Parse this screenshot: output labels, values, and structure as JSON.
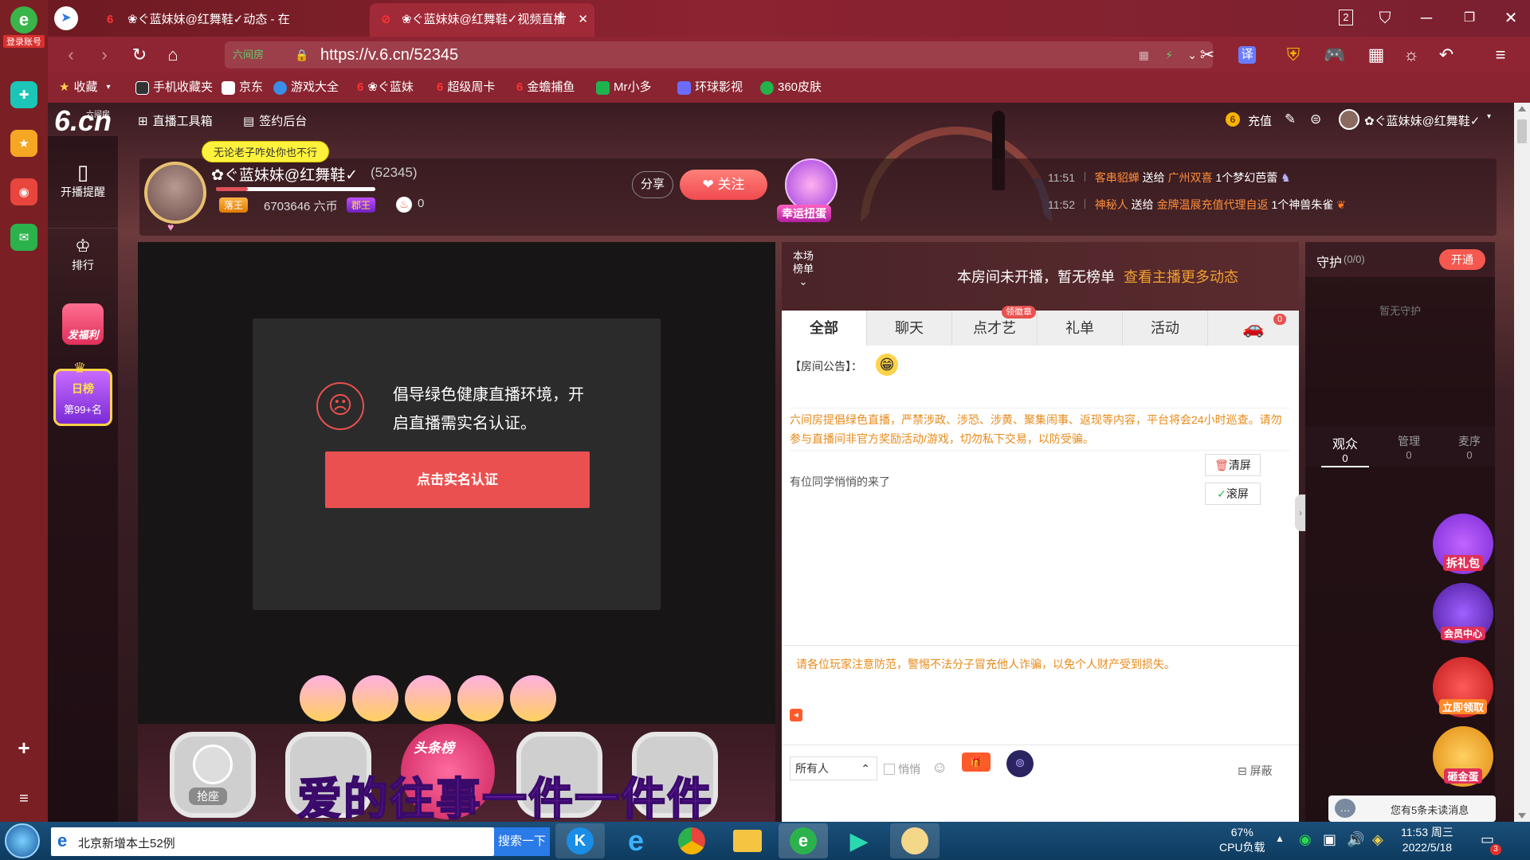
{
  "browser": {
    "login_label": "登录账号",
    "tabs": [
      {
        "title": "❀ぐ蓝妹妹@红舞鞋✓动态 - 在"
      },
      {
        "title": "❀ぐ蓝妹妹@红舞鞋✓视频直播"
      }
    ],
    "tab_count": "2",
    "url": "https://v.6.cn/52345",
    "site_badge": "六间房",
    "bookmarks": [
      {
        "label": "收藏"
      },
      {
        "label": "手机收藏夹"
      },
      {
        "label": "京东"
      },
      {
        "label": "游戏大全"
      },
      {
        "label": "❀ぐ蓝妹"
      },
      {
        "label": "超级周卡"
      },
      {
        "label": "金蟾捕鱼"
      },
      {
        "label": "Mr小多"
      },
      {
        "label": "环球影视"
      },
      {
        "label": "360皮肤"
      }
    ]
  },
  "site": {
    "logo": "6.cn",
    "logo_sub": "六间房",
    "tools": [
      "直播工具箱",
      "签约后台"
    ],
    "recharge": "充值",
    "user_name": "✿ぐ蓝妹妹@红舞鞋✓",
    "left_nav": [
      {
        "label": "开播提醒"
      },
      {
        "label": "排行"
      },
      {
        "label": "发福利"
      },
      {
        "label": "日榜",
        "sub": "第99+名"
      }
    ]
  },
  "anchor": {
    "tooltip": "无论老子咋处你也不行",
    "name": "✿ぐ蓝妹妹@红舞鞋✓",
    "room_id": "(52345)",
    "badge1": "落王",
    "coins": "6703646 六币",
    "badge2": "郡王",
    "heat": "0",
    "share": "分享",
    "follow": "关注",
    "lucky": "幸运扭蛋"
  },
  "feed": [
    {
      "time": "11:51",
      "from": "客串貂蝉",
      "verb": "送给",
      "to": "广州双喜",
      "gift": "1个梦幻芭蕾"
    },
    {
      "time": "11:52",
      "from": "神秘人",
      "verb": "送给",
      "to": "金牌温展充值代理自返",
      "gift": "1个神兽朱雀"
    }
  ],
  "video": {
    "notice_line1": "倡导绿色健康直播环境，开",
    "notice_line2": "启直播需实名认证。",
    "auth_button": "点击实名认证",
    "seat_label": "抢座",
    "headline_badge": "头条榜",
    "lyrics": "爱的往事一件一件件"
  },
  "rank": {
    "label_line1": "本场",
    "label_line2": "榜单",
    "empty": "本房间未开播，暂无榜单",
    "link": "查看主播更多动态"
  },
  "chat": {
    "tabs": [
      "全部",
      "聊天",
      "点才艺",
      "礼单",
      "活动"
    ],
    "tab_badge": "领徽章",
    "car_count": "0",
    "announce_label": "【房间公告】：",
    "rules": "六间房提倡绿色直播，严禁涉政、涉恐、涉黄、聚集闹事、返现等内容，平台将会24小时巡查。请勿参与直播间非官方奖励活动/游戏，切勿私下交易，以防受骗。",
    "message": "有位同学悄悄的来了",
    "clear": "清屏",
    "scroll": "滚屏",
    "warning": "请各位玩家注意防范，警惕不法分子冒充他人诈骗，以免个人财产受到损失。",
    "target": "所有人",
    "whisper": "悄悄",
    "block": "屏蔽"
  },
  "guard": {
    "title": "守护",
    "count": "(0/0)",
    "open": "开通",
    "empty": "暂无守护",
    "tabs": [
      {
        "label": "观众",
        "count": "0"
      },
      {
        "label": "管理",
        "count": "0"
      },
      {
        "label": "麦序",
        "count": "0"
      }
    ]
  },
  "float_buttons": [
    "拆礼包",
    "会员中心",
    "立即领取",
    "砸金蛋"
  ],
  "unread": "您有5条未读消息",
  "taskbar": {
    "search_text": "北京新增本土52例",
    "search_button": "搜索一下",
    "cpu_percent": "67%",
    "cpu_label": "CPU负载",
    "time": "11:53 周三",
    "date": "2022/5/18",
    "notif_count": "3"
  },
  "colors": {
    "accent": "#e9504f",
    "follow": "#f5665f",
    "link_orange": "#f0a030",
    "feed_orange": "#ff8c3a",
    "gold": "#ffd34a"
  }
}
